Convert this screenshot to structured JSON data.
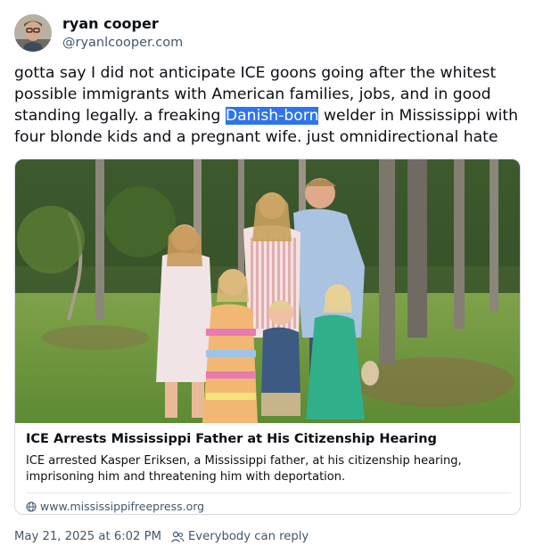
{
  "author": {
    "display_name": "ryan cooper",
    "handle": "@ryanlcooper.com",
    "avatar_icon": "avatar-photo"
  },
  "post": {
    "text_before": "gotta say I did not anticipate ICE goons going after the whitest possible immigrants with American families, jobs, and in good standing legally. a freaking ",
    "highlighted": "Danish-born",
    "text_after": " welder in Mississippi with four blonde kids and a pregnant wife. just omnidirectional hate"
  },
  "link_card": {
    "image_icon": "family-photo",
    "title": "ICE Arrests Mississippi Father at His Citizenship Hearing",
    "description": "ICE arrested Kasper Eriksen, a Mississippi father, at his citizenship hearing, imprisoning him and threatening him with deportation.",
    "domain": "www.mississippifreepress.org",
    "domain_icon": "globe-icon"
  },
  "footer": {
    "timestamp": "May 21, 2025 at 6:02 PM",
    "reply_icon": "people-icon",
    "reply_setting": "Everybody can reply"
  },
  "colors": {
    "highlight": "#2f74ea",
    "secondary_text": "#42576c",
    "border": "#d4dbe2"
  }
}
